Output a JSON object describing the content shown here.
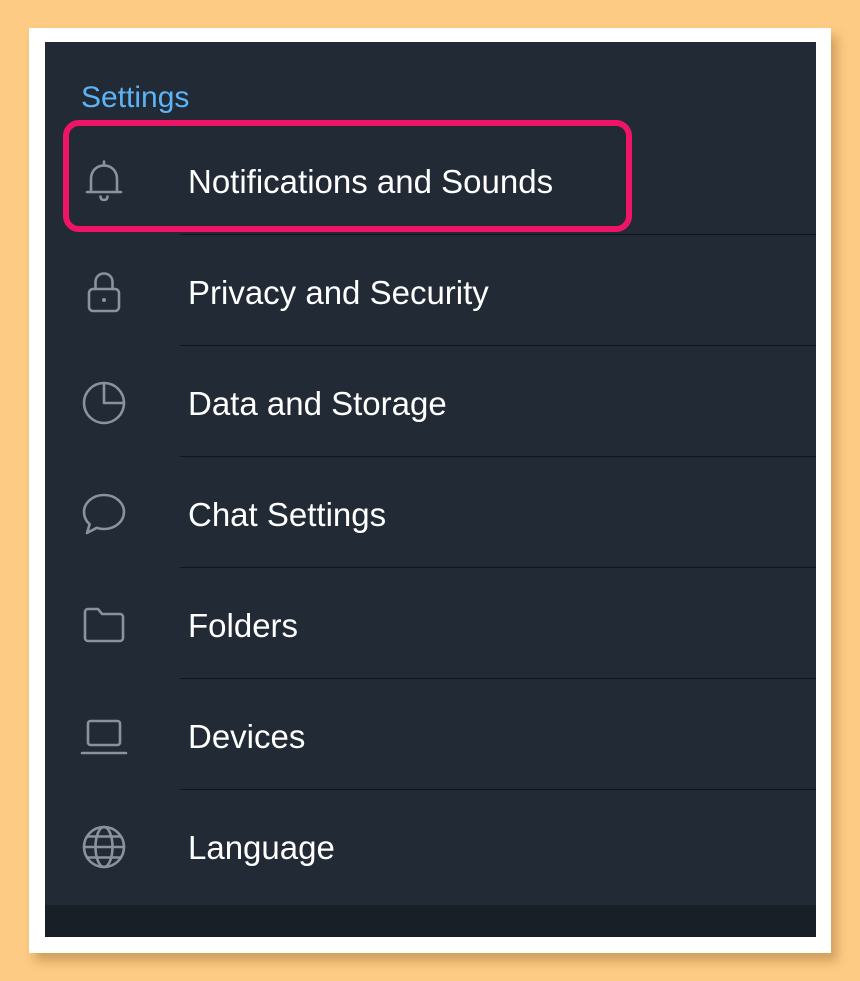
{
  "section": {
    "title": "Settings"
  },
  "items": [
    {
      "label": "Notifications and Sounds",
      "icon": "bell-icon"
    },
    {
      "label": "Privacy and Security",
      "icon": "lock-icon"
    },
    {
      "label": "Data and Storage",
      "icon": "pie-chart-icon"
    },
    {
      "label": "Chat Settings",
      "icon": "chat-bubble-icon"
    },
    {
      "label": "Folders",
      "icon": "folder-icon"
    },
    {
      "label": "Devices",
      "icon": "laptop-icon"
    },
    {
      "label": "Language",
      "icon": "globe-icon"
    }
  ],
  "colors": {
    "page_background": "#fecb84",
    "screen_background": "#212a35",
    "section_title": "#5cb3f5",
    "icon": "#8a939d",
    "highlight": "#f01467"
  }
}
